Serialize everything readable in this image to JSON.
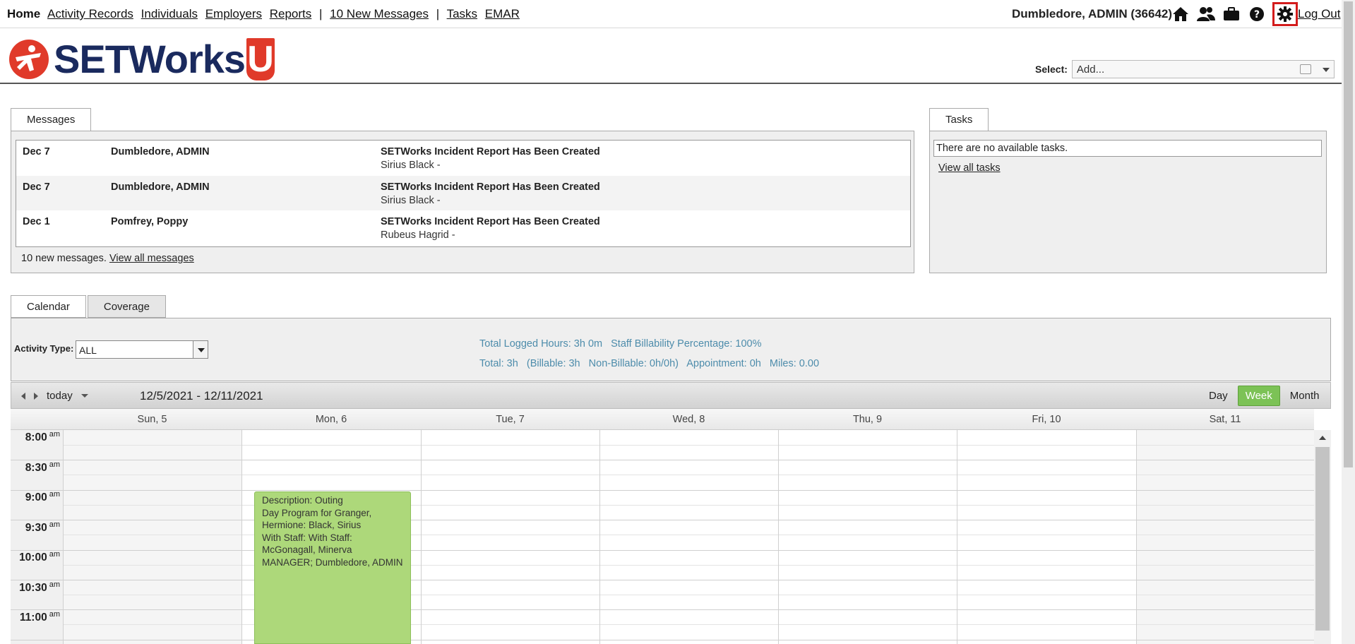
{
  "nav": {
    "home": "Home",
    "activity_records": "Activity Records",
    "individuals": "Individuals",
    "employers": "Employers",
    "reports": "Reports",
    "sep1": "|",
    "new_messages": "10 New Messages",
    "sep2": "|",
    "tasks": "Tasks",
    "emar": "EMAR",
    "user": "Dumbledore, ADMIN  (36642)",
    "logout": "Log Out",
    "icons": [
      "home-icon",
      "users-icon",
      "briefcase-icon",
      "help-icon",
      "gear-icon"
    ]
  },
  "logo": {
    "word": "SETWorks",
    "letter": "U"
  },
  "select": {
    "label": "Select:",
    "value": "Add..."
  },
  "messages": {
    "tab": "Messages",
    "rows": [
      {
        "date": "Dec 7",
        "from": "Dumbledore, ADMIN",
        "subject": "SETWorks Incident Report Has Been Created",
        "detail": "Sirius Black -"
      },
      {
        "date": "Dec 7",
        "from": "Dumbledore, ADMIN",
        "subject": "SETWorks Incident Report Has Been Created",
        "detail": "Sirius Black -"
      },
      {
        "date": "Dec 1",
        "from": "Pomfrey, Poppy",
        "subject": "SETWorks Incident Report Has Been Created",
        "detail": "Rubeus Hagrid -"
      }
    ],
    "footer_text": "10 new messages. ",
    "footer_link": "View all messages"
  },
  "tasks": {
    "tab": "Tasks",
    "empty": "There are no available tasks.",
    "link": "View all tasks"
  },
  "calendar": {
    "tabs": [
      "Calendar",
      "Coverage"
    ],
    "activity_type_label": "Activity Type:",
    "activity_type_value": "ALL",
    "stats_line1": [
      "Total Logged Hours: 3h 0m",
      "Staff Billability Percentage: 100%"
    ],
    "stats_line2": [
      "Total: 3h",
      "(Billable: 3h",
      "Non-Billable: 0h/0h)",
      "Appointment: 0h",
      "Miles: 0.00"
    ],
    "today": "today",
    "range": "12/5/2021 - 12/11/2021",
    "views": [
      "Day",
      "Week",
      "Month"
    ],
    "active_view": "Week",
    "days": [
      "Sun, 5",
      "Mon, 6",
      "Tue, 7",
      "Wed, 8",
      "Thu, 9",
      "Fri, 10",
      "Sat, 11"
    ],
    "times": [
      "8:00",
      "8:30",
      "9:00",
      "9:30",
      "10:00",
      "10:30",
      "11:00"
    ],
    "ampm": "am",
    "event": {
      "line1": "Description: Outing",
      "line2": "Day Program for Granger, Hermione: Black, Sirius",
      "line3": "With Staff: With Staff: McGonagall, Minerva MANAGER; Dumbledore, ADMIN",
      "color": "#add87a"
    }
  },
  "colors": {
    "accent_green": "#7cc256",
    "stats_text": "#4d8cab",
    "alert_red": "#c0262c",
    "logo_navy": "#1a2a5e",
    "logo_red": "#e03a2a"
  }
}
